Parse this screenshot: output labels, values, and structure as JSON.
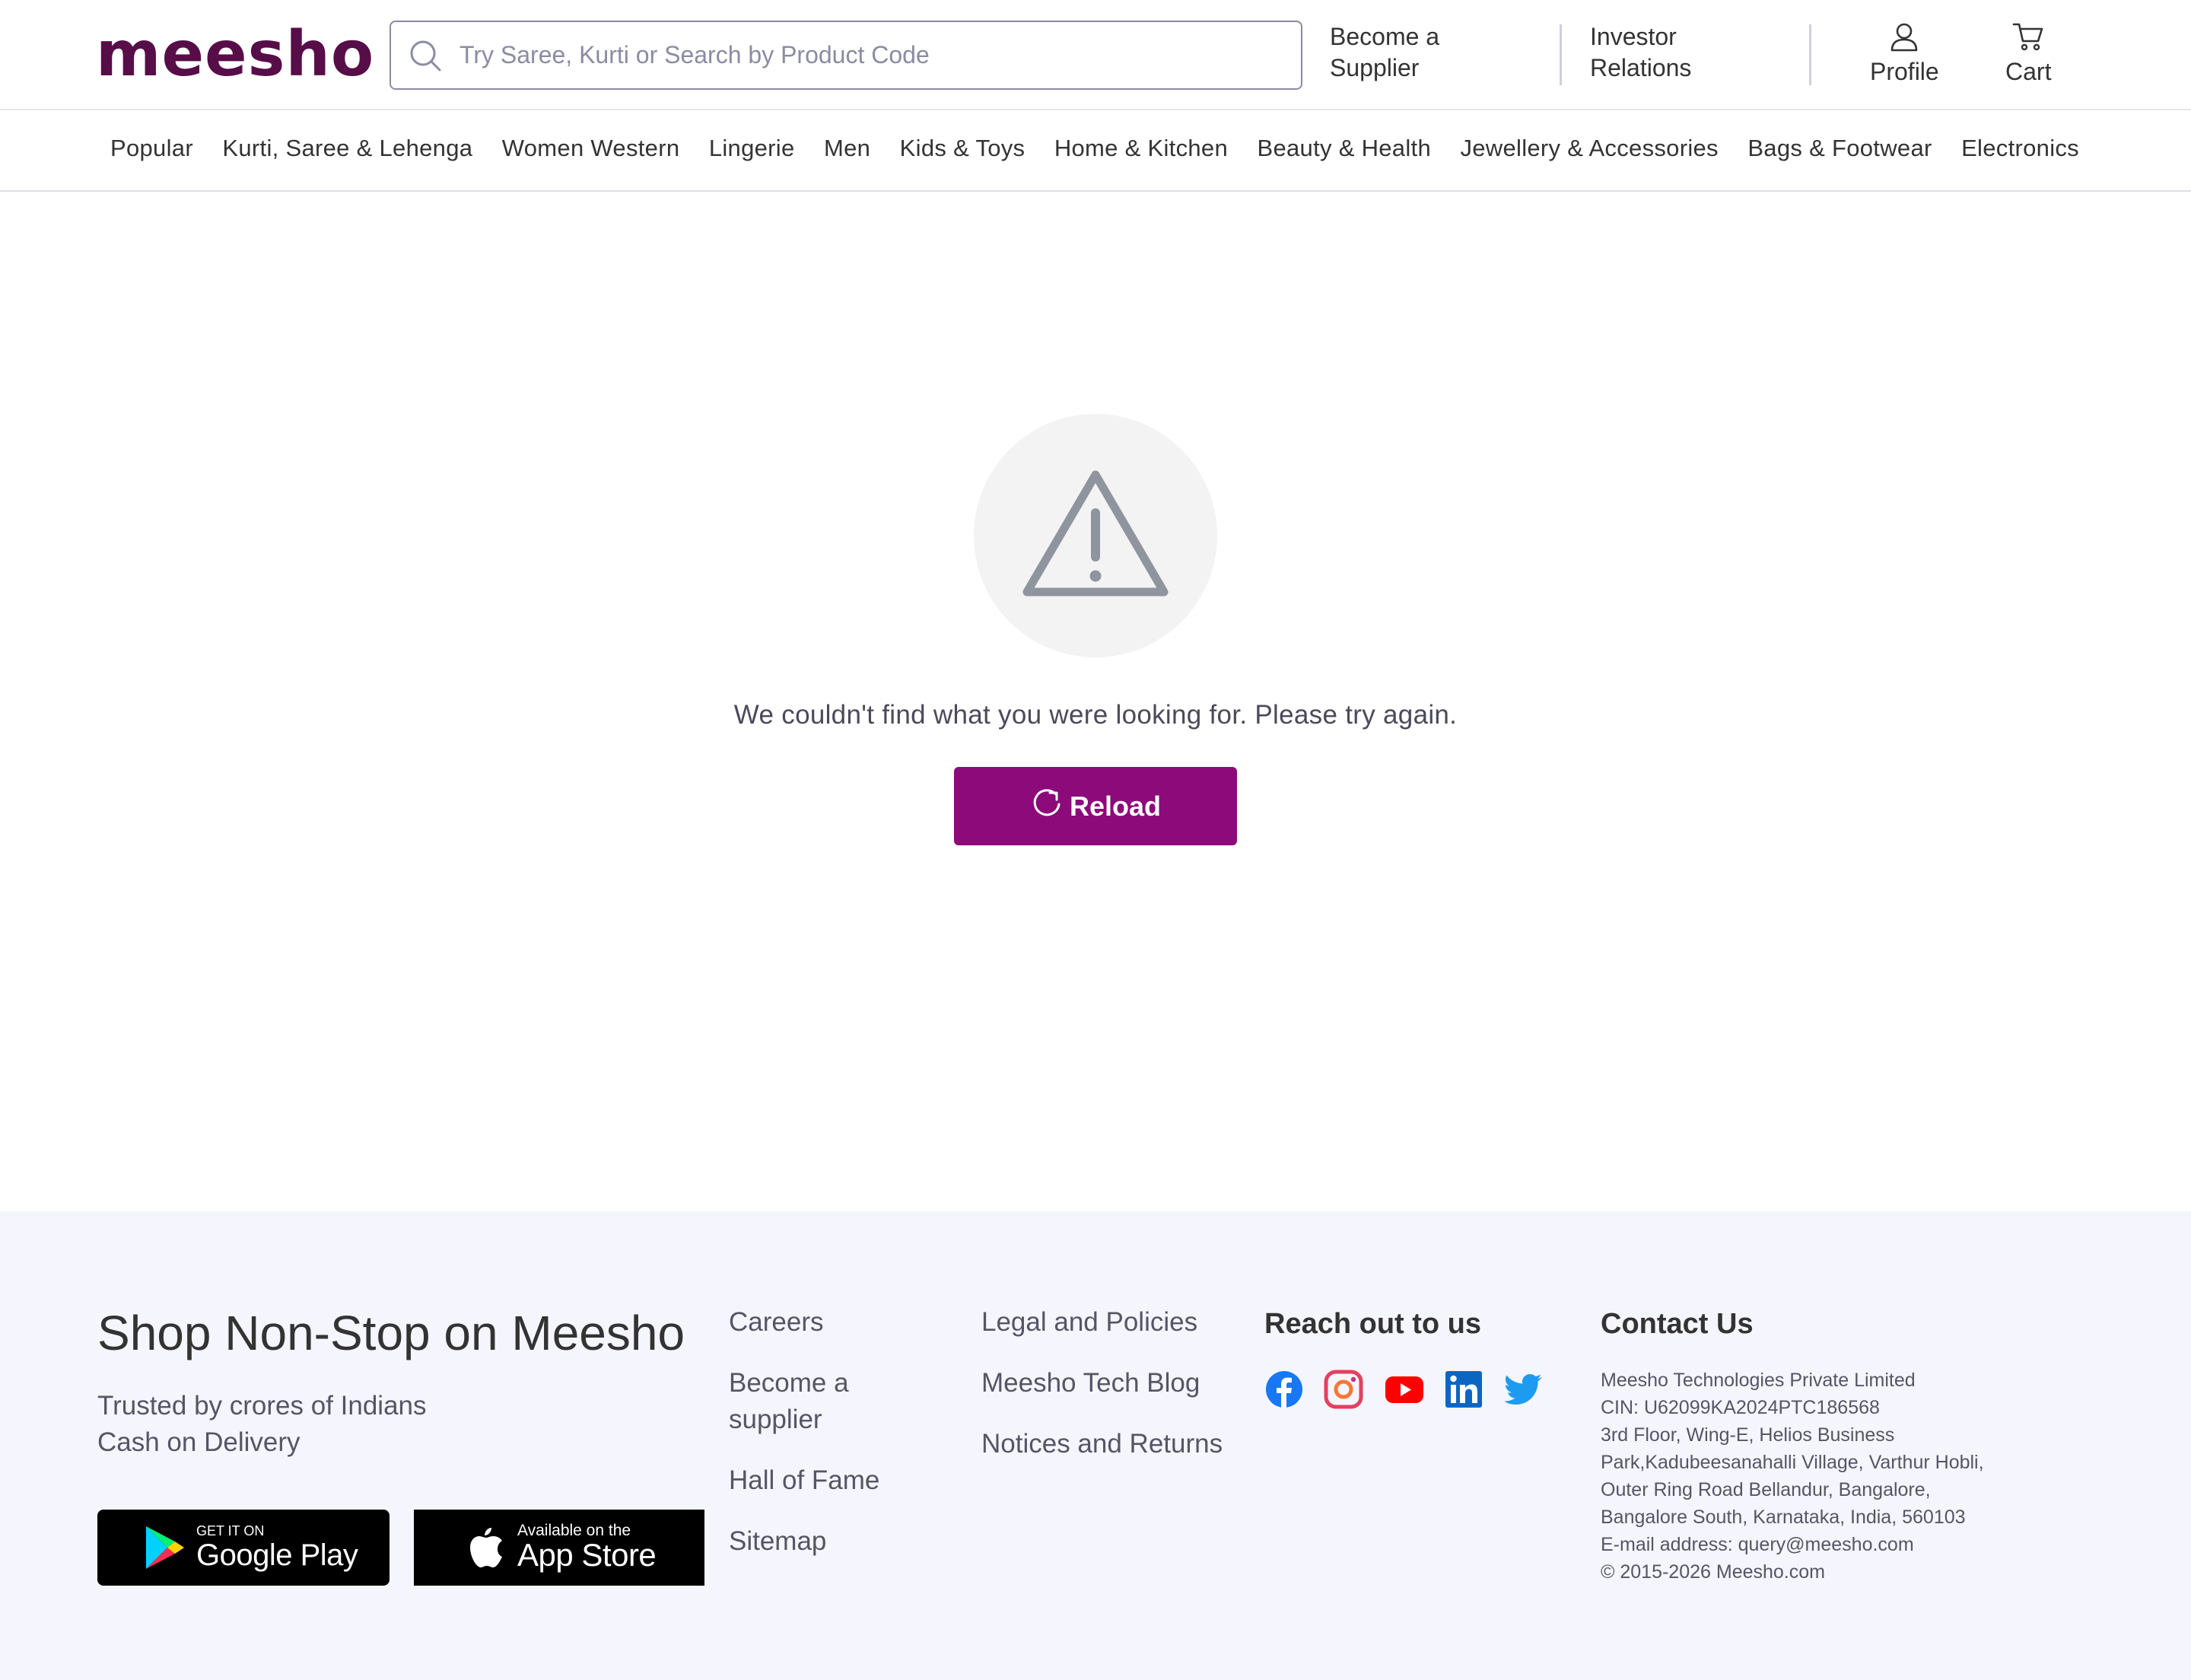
{
  "header": {
    "logo": "meesho",
    "search_placeholder": "Try Saree, Kurti or Search by Product Code",
    "become_supplier": [
      "Become a",
      "Supplier"
    ],
    "investor_relations": [
      "Investor",
      "Relations"
    ],
    "profile_label": "Profile",
    "cart_label": "Cart"
  },
  "categories": [
    "Popular",
    "Kurti, Saree & Lehenga",
    "Women Western",
    "Lingerie",
    "Men",
    "Kids & Toys",
    "Home & Kitchen",
    "Beauty & Health",
    "Jewellery & Accessories",
    "Bags & Footwear",
    "Electronics"
  ],
  "main": {
    "icon": "warning-triangle-icon",
    "message": "We couldn't find what you were looking for. Please try again.",
    "reload_label": "Reload"
  },
  "footer": {
    "title": "Shop Non-Stop on Meesho",
    "subtitle_lines": [
      "Trusted by crores of Indians",
      "Cash on Delivery"
    ],
    "google_play": {
      "small": "GET IT ON",
      "big": "Google Play"
    },
    "app_store": {
      "small": "Available on the",
      "big": "App Store"
    },
    "col1": {
      "careers": "Careers",
      "become_supplier": [
        "Become a",
        "supplier"
      ],
      "hall_of_fame": "Hall of Fame",
      "sitemap": "Sitemap"
    },
    "col2": [
      "Legal and Policies",
      "Meesho Tech Blog",
      "Notices and Returns"
    ],
    "reach_out": {
      "heading": "Reach out to us",
      "icons": [
        "facebook-icon",
        "instagram-icon",
        "youtube-icon",
        "linkedin-icon",
        "twitter-icon"
      ]
    },
    "contact": {
      "heading": "Contact Us",
      "lines": [
        "Meesho Technologies Private Limited",
        "CIN: U62099KA2024PTC186568",
        "3rd Floor, Wing-E, Helios Business",
        "Park,Kadubeesanahalli Village, Varthur Hobli,",
        "Outer Ring Road Bellandur, Bangalore,",
        "Bangalore South, Karnataka, India, 560103",
        "E-mail address: query@meesho.com",
        "© 2015-2026 Meesho.com"
      ]
    }
  },
  "colors": {
    "brand": "#570d48",
    "button": "#8c0a7a",
    "footer_bg": "#f5f5fe"
  }
}
